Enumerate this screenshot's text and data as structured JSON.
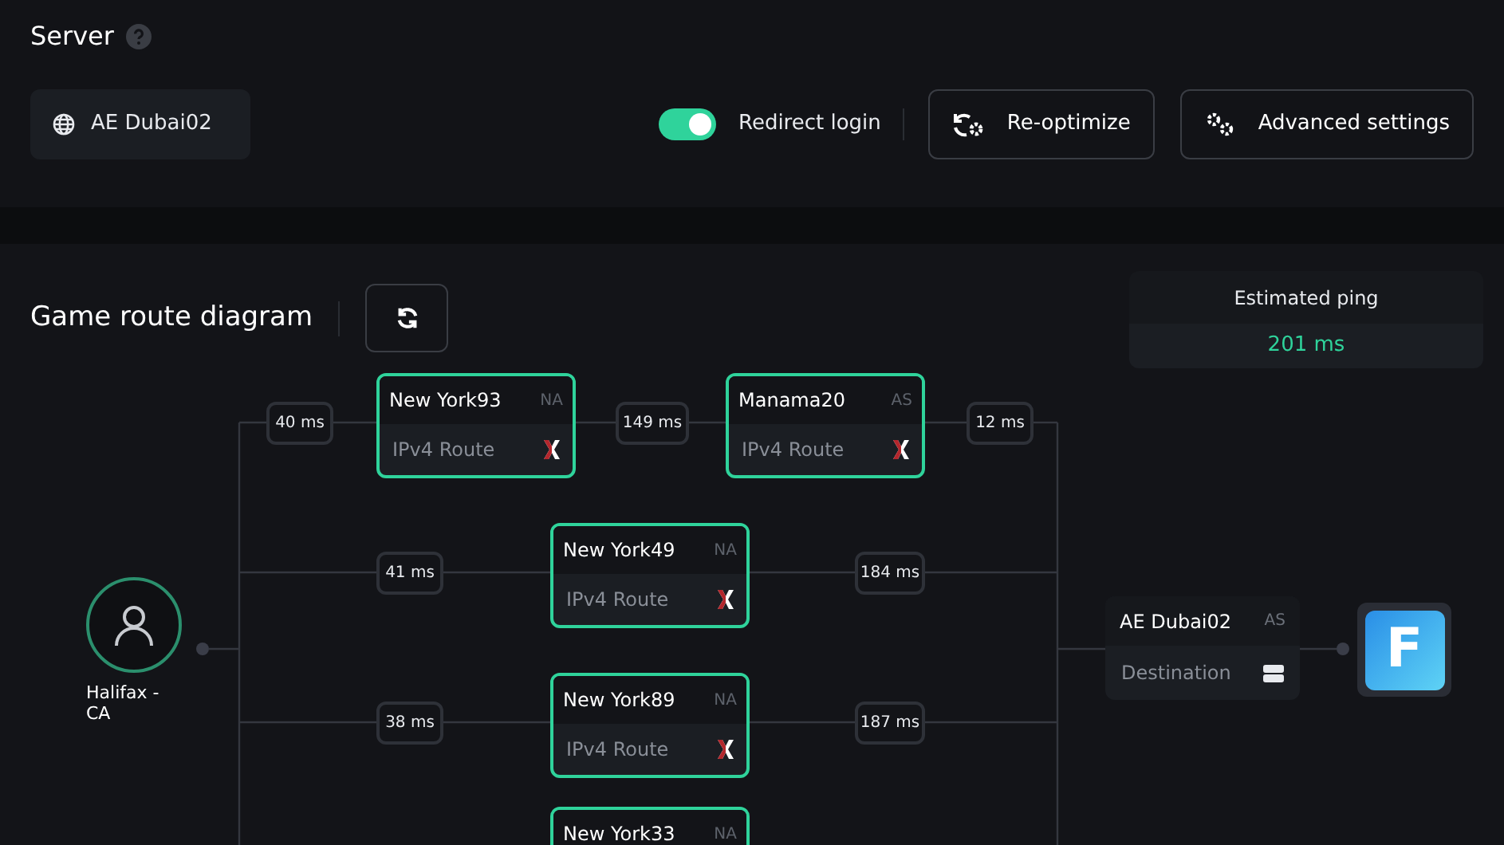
{
  "server": {
    "title": "Server",
    "region": "AE Dubai02",
    "redirect_login": {
      "label": "Redirect login",
      "on": true
    },
    "buttons": [
      {
        "label": "Re-optimize",
        "kind": "reoptimize"
      },
      {
        "label": "Advanced settings",
        "kind": "settings"
      }
    ]
  },
  "diagram": {
    "title": "Game route diagram",
    "estimated_ping": {
      "label": "Estimated ping",
      "value": "201 ms"
    },
    "origin": {
      "name": "Halifax - CA"
    },
    "routes": [
      {
        "nodes": [
          {
            "name": "New York93",
            "region": "NA",
            "type": "IPv4 Route"
          },
          {
            "name": "Manama20",
            "region": "AS",
            "type": "IPv4 Route"
          }
        ],
        "latencies": [
          "40 ms",
          "149 ms",
          "12 ms"
        ]
      },
      {
        "nodes": [
          {
            "name": "New York49",
            "region": "NA",
            "type": "IPv4 Route"
          }
        ],
        "latencies": [
          "41 ms",
          "184 ms"
        ]
      },
      {
        "nodes": [
          {
            "name": "New York89",
            "region": "NA",
            "type": "IPv4 Route"
          }
        ],
        "latencies": [
          "38 ms",
          "187 ms"
        ]
      },
      {
        "nodes": [
          {
            "name": "New York33",
            "region": "NA"
          }
        ]
      }
    ],
    "destination": {
      "name": "AE Dubai02",
      "region": "AS",
      "type": "Destination"
    },
    "game_logo": {
      "letter": "F"
    }
  }
}
